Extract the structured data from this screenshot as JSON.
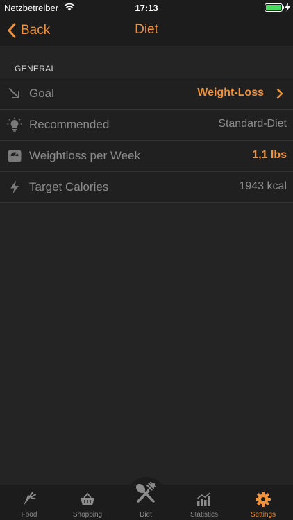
{
  "status": {
    "carrier": "Netzbetreiber",
    "time": "17:13",
    "battery_level": 1.0,
    "battery_color": "#4cd964"
  },
  "nav": {
    "back_label": "Back",
    "title": "Diet"
  },
  "section": {
    "header": "GENERAL"
  },
  "rows": [
    {
      "label": "Goal",
      "value": "Weight-Loss",
      "icon": "trend-down-arrow-icon"
    },
    {
      "label": "Recommended",
      "value": "Standard-Diet",
      "icon": "lightbulb-icon"
    },
    {
      "label": "Weightloss per Week",
      "value": "1,1  lbs",
      "icon": "scale-icon"
    },
    {
      "label": "Target Calories",
      "value": "1943 kcal",
      "icon": "lightning-icon"
    }
  ],
  "tabs": [
    {
      "label": "Food",
      "icon": "carrot-icon"
    },
    {
      "label": "Shopping",
      "icon": "basket-icon"
    },
    {
      "label": "Diet",
      "icon": "spoon-fork-icon"
    },
    {
      "label": "Statistics",
      "icon": "bar-chart-icon"
    },
    {
      "label": "Settings",
      "icon": "gear-icon"
    }
  ],
  "colors": {
    "accent": "#f0923a",
    "background": "#242424",
    "bar": "#1c1c1c",
    "muted_text": "#8c8c8c"
  }
}
